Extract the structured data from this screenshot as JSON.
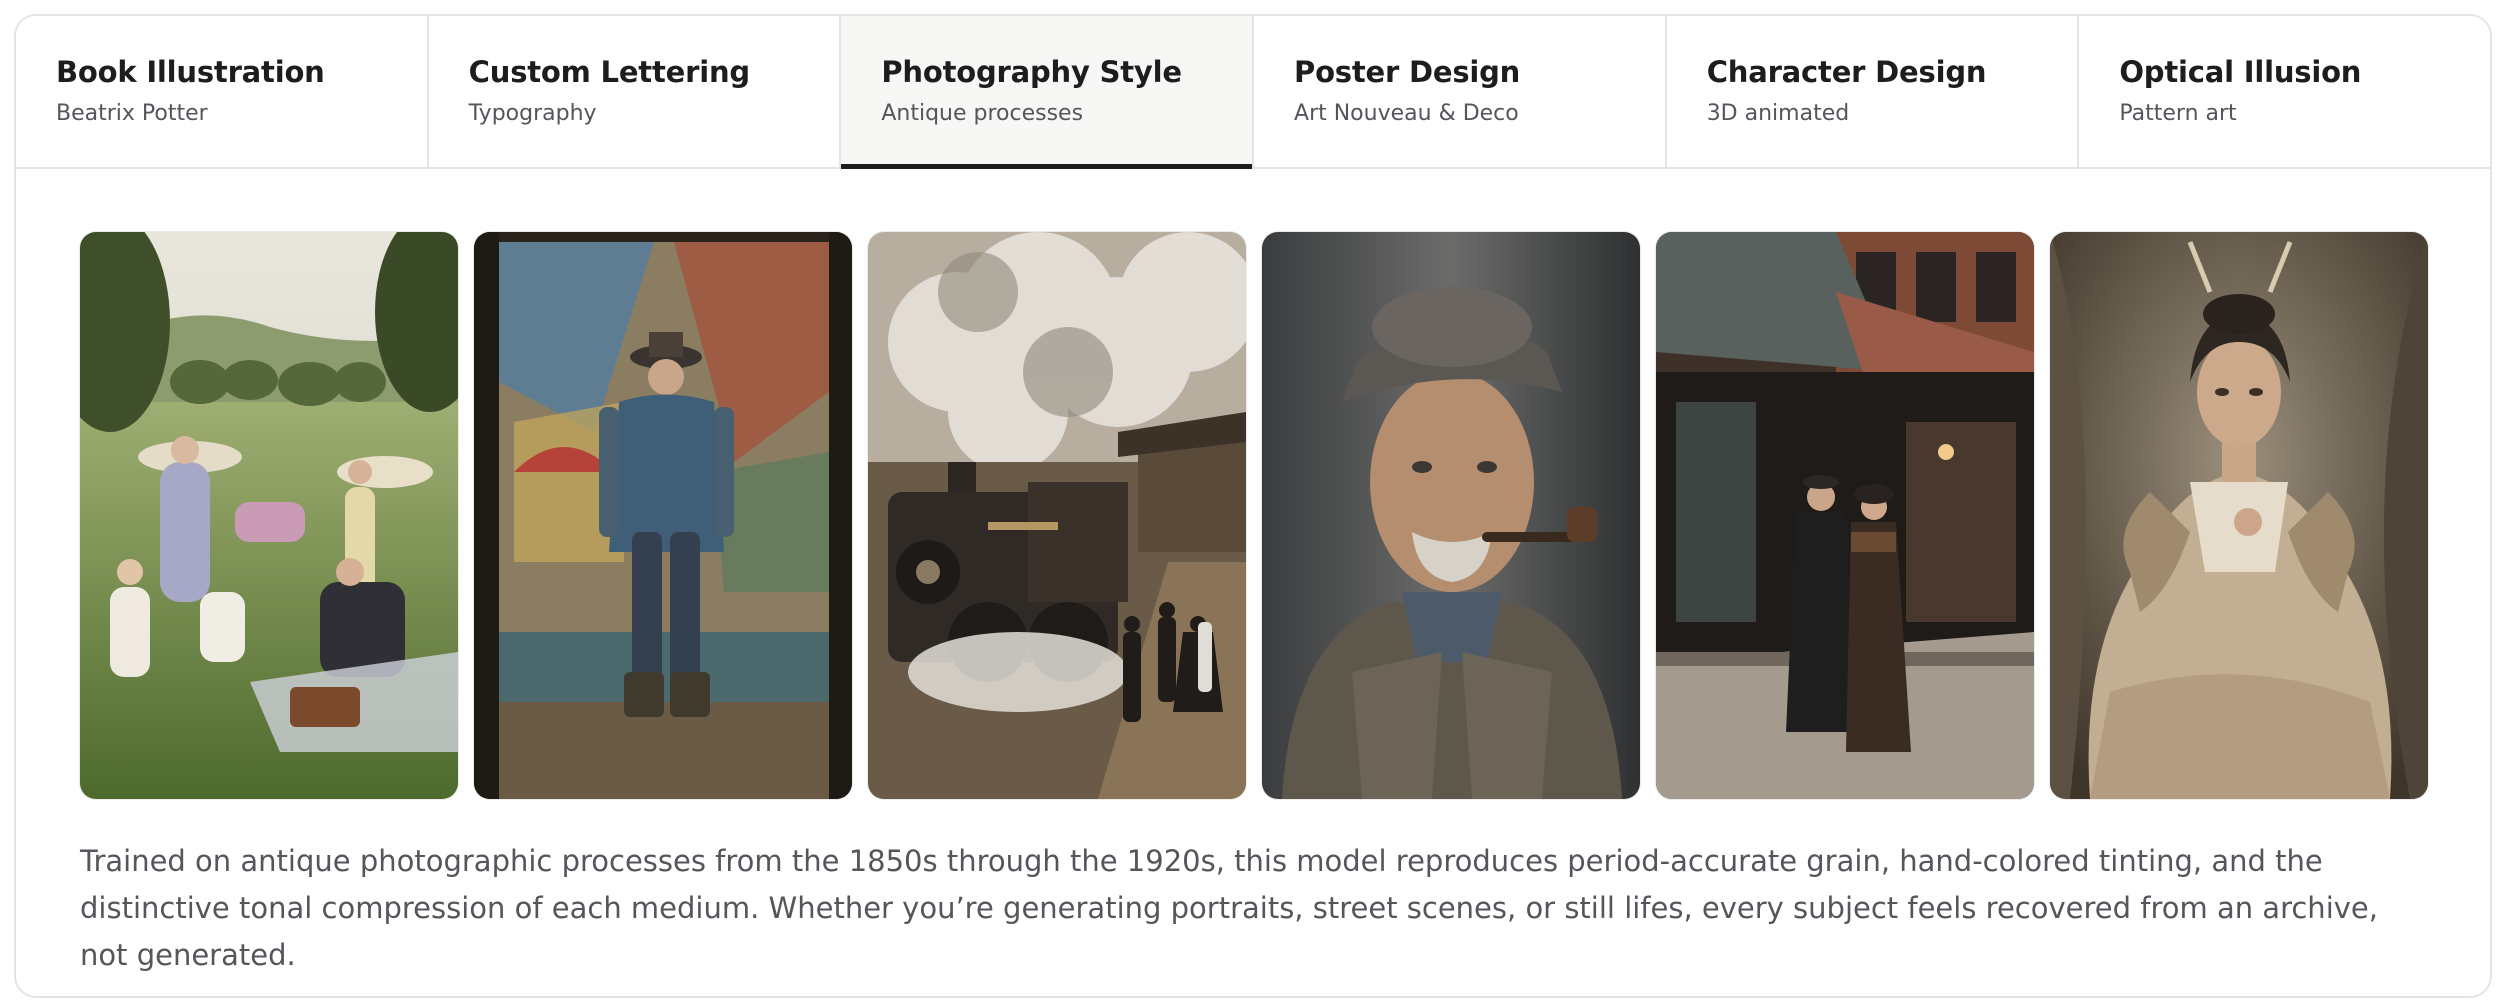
{
  "tabs": [
    {
      "title": "Book Illustration",
      "subtitle": "Beatrix Potter",
      "active": false
    },
    {
      "title": "Custom Lettering",
      "subtitle": "Typography",
      "active": false
    },
    {
      "title": "Photography Style",
      "subtitle": "Antique processes",
      "active": true
    },
    {
      "title": "Poster Design",
      "subtitle": "Art Nouveau & Deco",
      "active": false
    },
    {
      "title": "Character Design",
      "subtitle": "3D animated",
      "active": false
    },
    {
      "title": "Optical Illusion",
      "subtitle": "Pattern art",
      "active": false
    }
  ],
  "description": "Trained on antique photographic processes from the 1850s through the 1920s, this model reproduces period-accurate grain, hand-colored tinting, and the distinctive tonal compression of each medium. Whether you’re generating portraits, street scenes, or still lifes, every subject feels recovered from an archive, not generated.",
  "colors": {
    "text_primary": "#1d1d1f",
    "text_secondary": "#55565b",
    "border": "#e4e4e6",
    "active_tab_bg": "#f7f7f6",
    "active_indicator": "#1d1d1f"
  }
}
